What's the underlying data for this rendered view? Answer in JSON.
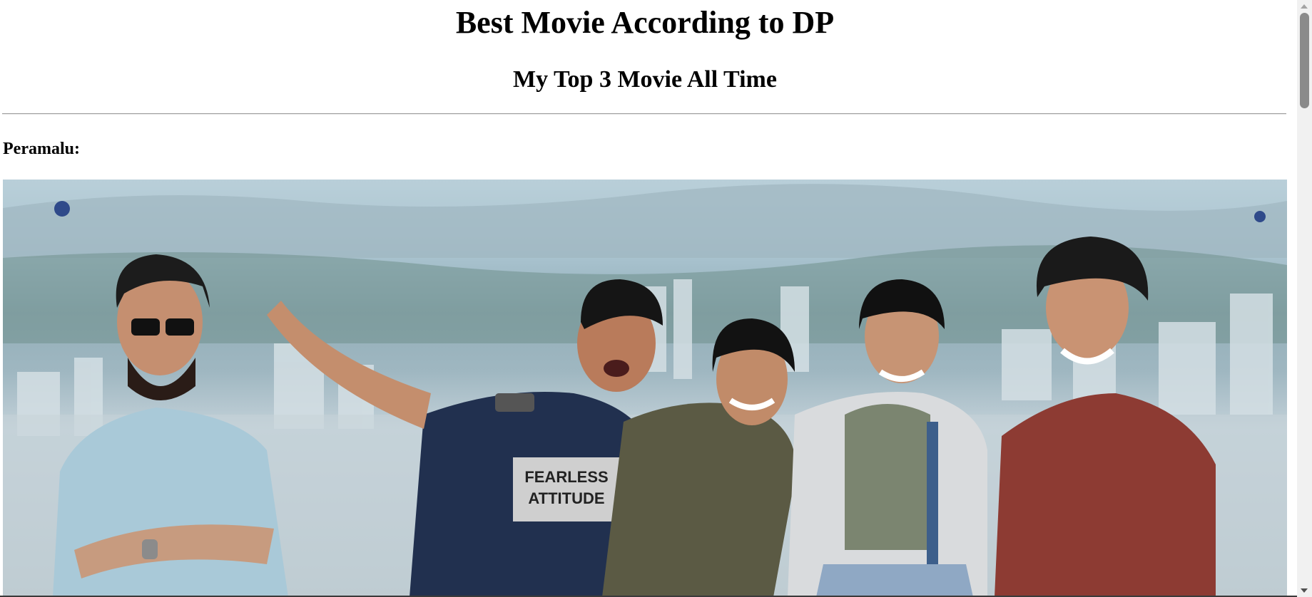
{
  "page": {
    "title": "Best Movie According to DP",
    "subtitle": "My Top 3 Movie All Time"
  },
  "movies": [
    {
      "label": "Peramalu:",
      "image": {
        "shirt_text_line1": "FEARLESS",
        "shirt_text_line2": "ATTITUDE"
      }
    }
  ],
  "colors": {
    "background": "#ffffff",
    "text": "#000000",
    "divider": "#9a9a9a"
  },
  "icons": {
    "scroll_up": "scroll-up-arrow-icon",
    "scroll_down": "scroll-down-arrow-icon"
  }
}
